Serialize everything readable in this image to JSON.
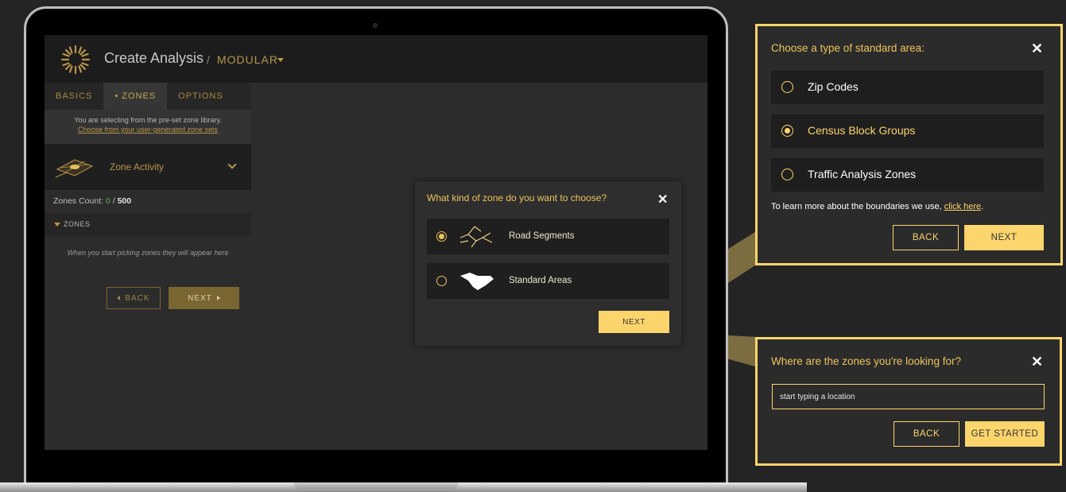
{
  "app": {
    "title": "Create Analysis",
    "separator": "/",
    "mode": "MODULAR"
  },
  "sidebar": {
    "tabs": [
      {
        "label": "BASICS",
        "active": false
      },
      {
        "label": "• ZONES",
        "active": true
      },
      {
        "label": "OPTIONS",
        "active": false
      }
    ],
    "library_note": "You are selecting from the pre-set zone library.",
    "library_link": "Choose from your user-generated zone sets",
    "zone_activity_label": "Zone Activity",
    "zones_count_label": "Zones Count:",
    "zones_count_value": "0",
    "zones_count_sep": "/",
    "zones_count_max": "500",
    "zones_header": "ZONES",
    "zones_empty": "When you start picking zones they will appear here",
    "back_label": "BACK",
    "next_label": "NEXT"
  },
  "zone_dialog": {
    "title": "What kind of zone do you want to choose?",
    "close": "✕",
    "options": [
      {
        "label": "Road Segments",
        "selected": true,
        "icon": "road-segments-icon"
      },
      {
        "label": "Standard Areas",
        "selected": false,
        "icon": "standard-areas-icon"
      }
    ],
    "next_label": "NEXT"
  },
  "area_callout": {
    "title": "Choose a type of standard area:",
    "close": "✕",
    "options": [
      {
        "label": "Zip Codes",
        "selected": false
      },
      {
        "label": "Census Block Groups",
        "selected": true
      },
      {
        "label": "Traffic Analysis Zones",
        "selected": false
      }
    ],
    "learn_text": "To learn more about the boundaries we use, ",
    "learn_link": "click here",
    "learn_end": ".",
    "back_label": "BACK",
    "next_label": "NEXT"
  },
  "location_callout": {
    "title": "Where are the zones you're looking for?",
    "close": "✕",
    "input_placeholder": "start typing a location",
    "input_value": "",
    "back_label": "BACK",
    "start_label": "GET STARTED"
  },
  "colors": {
    "accent": "#fdd56d",
    "accent_dark": "#b8954a",
    "panel": "#2b2b2b",
    "option_bg": "#1e1e1e"
  }
}
